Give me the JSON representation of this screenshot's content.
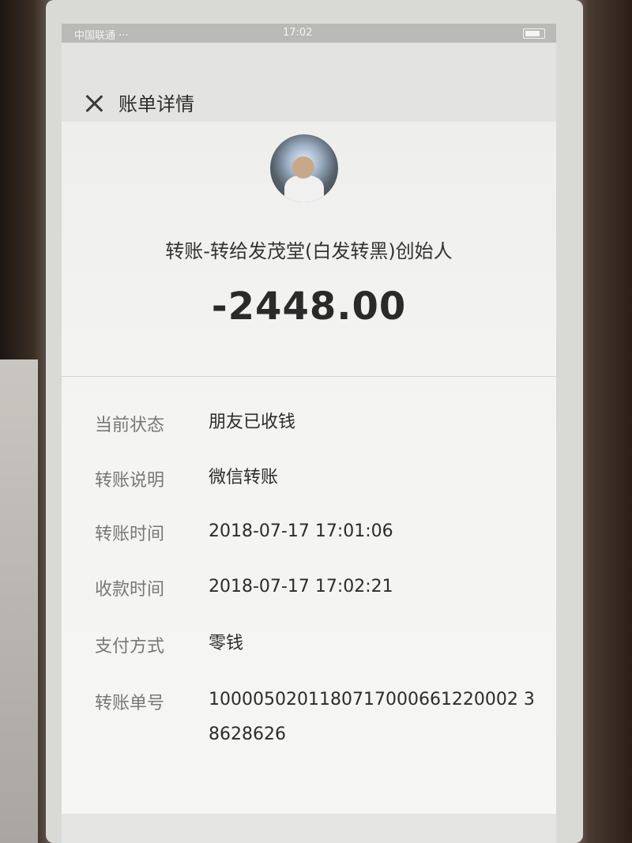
{
  "status_bar": {
    "carrier": "中国联通 ···",
    "time": "17:02"
  },
  "header": {
    "title": "账单详情",
    "close_icon": "close-icon"
  },
  "summary": {
    "payee": "转账-转给发茂堂(白发转黑)创始人",
    "amount": "-2448.00"
  },
  "details": [
    {
      "label": "当前状态",
      "value": "朋友已收钱"
    },
    {
      "label": "转账说明",
      "value": "微信转账"
    },
    {
      "label": "转账时间",
      "value": "2018-07-17 17:01:06"
    },
    {
      "label": "收款时间",
      "value": "2018-07-17 17:02:21"
    },
    {
      "label": "支付方式",
      "value": "零钱"
    },
    {
      "label": "转账单号",
      "value": "1000050201180717000661220002 38628626"
    }
  ]
}
